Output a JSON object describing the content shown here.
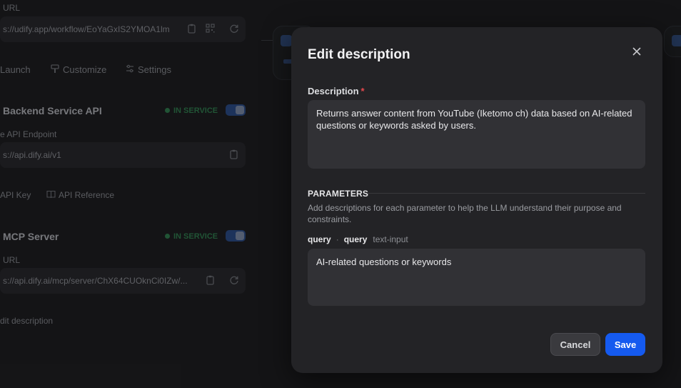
{
  "background": {
    "url_label": "URL",
    "workflow_url": "s://udify.app/workflow/EoYaGxIS2YMOA1lm",
    "nav": {
      "launch": "Launch",
      "customize": "Customize",
      "settings": "Settings"
    },
    "backend": {
      "title": "Backend Service API",
      "status": "IN SERVICE",
      "endpoint_label": "e API Endpoint",
      "endpoint": "s://api.dify.ai/v1",
      "api_key": "API Key",
      "api_reference": "API Reference"
    },
    "mcp": {
      "title": "MCP Server",
      "status": "IN SERVICE",
      "url_label": "URL",
      "url": "s://api.dify.ai/mcp/server/ChX64CUOknCi0IZw/...",
      "edit_description": "dit description"
    }
  },
  "modal": {
    "title": "Edit description",
    "description_label": "Description",
    "required_mark": "*",
    "description_value": "Returns answer content from YouTube (Iketomo ch) data based on AI-related questions or keywords asked by users.",
    "parameters_heading": "PARAMETERS",
    "parameters_help": "Add descriptions for each parameter to help the LLM understand their purpose and constraints.",
    "param": {
      "name": "query",
      "separator": "·",
      "variable": "query",
      "type": "text-input"
    },
    "param_value": "AI-related questions or keywords",
    "cancel_label": "Cancel",
    "save_label": "Save"
  },
  "colors": {
    "accent": "#155aef",
    "status_green": "#2e7d4c",
    "required": "#e5484d"
  }
}
